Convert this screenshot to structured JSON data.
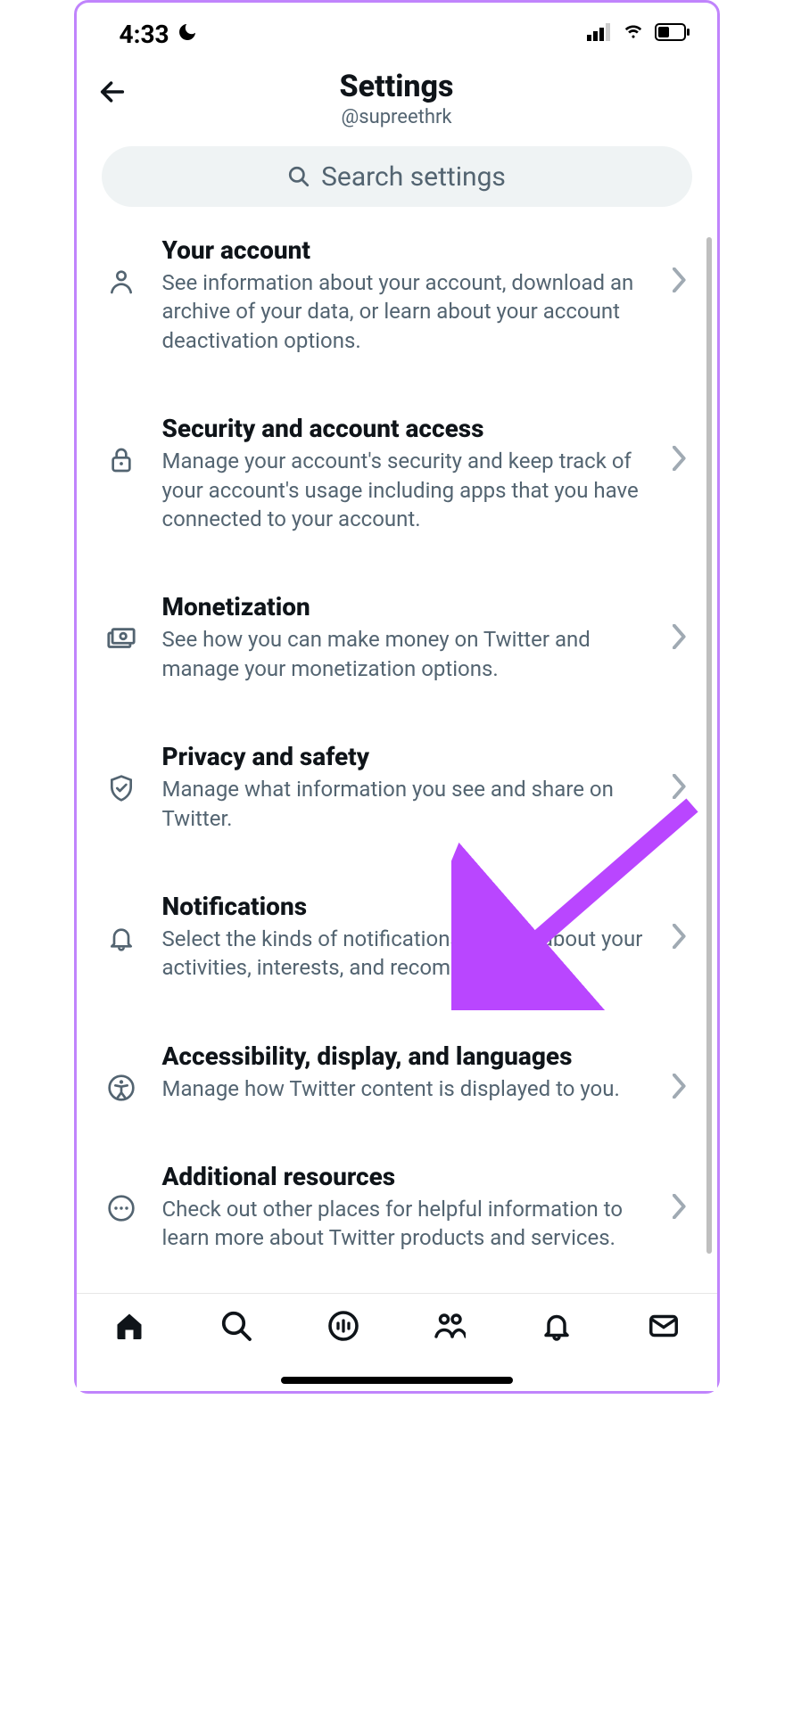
{
  "statusBar": {
    "time": "4:33"
  },
  "header": {
    "title": "Settings",
    "username": "@supreethrk"
  },
  "search": {
    "placeholder": "Search settings"
  },
  "items": [
    {
      "title": "Your account",
      "desc": "See information about your account, download an archive of your data, or learn about your account deactivation options."
    },
    {
      "title": "Security and account access",
      "desc": "Manage your account's security and keep track of your account's usage including apps that you have connected to your account."
    },
    {
      "title": "Monetization",
      "desc": "See how you can make money on Twitter and manage your monetization options."
    },
    {
      "title": "Privacy and safety",
      "desc": "Manage what information you see and share on Twitter."
    },
    {
      "title": "Notifications",
      "desc": "Select the kinds of notifications you get about your activities, interests, and recommendations."
    },
    {
      "title": "Accessibility, display, and languages",
      "desc": "Manage how Twitter content is displayed to you."
    },
    {
      "title": "Additional resources",
      "desc": "Check out other places for helpful information to learn more about Twitter products and services."
    }
  ]
}
